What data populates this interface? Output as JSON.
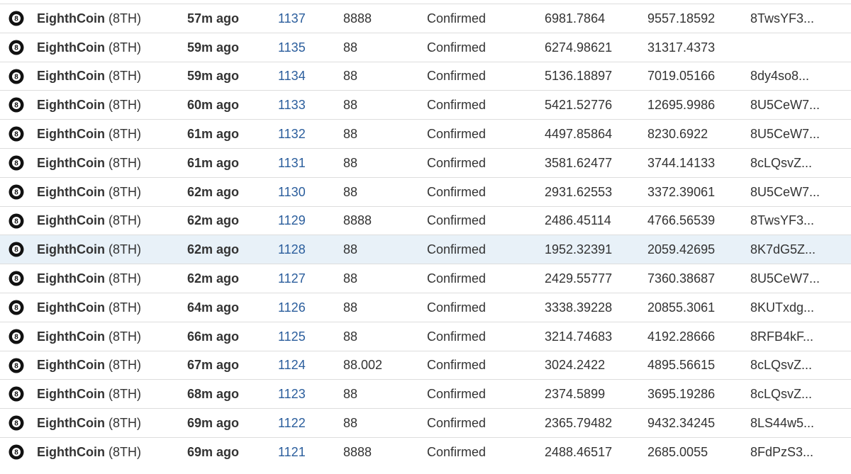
{
  "rows": [
    {
      "coin": "EighthCoin",
      "symbol": "(8TH)",
      "time": "57m ago",
      "height": "1137",
      "difficulty": "8888",
      "status": "Confirmed",
      "value_a": "6981.7864",
      "value_b": "9557.18592",
      "address": "8TwsYF3..."
    },
    {
      "coin": "EighthCoin",
      "symbol": "(8TH)",
      "time": "59m ago",
      "height": "1135",
      "difficulty": "88",
      "status": "Confirmed",
      "value_a": "6274.98621",
      "value_b": "31317.4373",
      "address": ""
    },
    {
      "coin": "EighthCoin",
      "symbol": "(8TH)",
      "time": "59m ago",
      "height": "1134",
      "difficulty": "88",
      "status": "Confirmed",
      "value_a": "5136.18897",
      "value_b": "7019.05166",
      "address": "8dy4so8..."
    },
    {
      "coin": "EighthCoin",
      "symbol": "(8TH)",
      "time": "60m ago",
      "height": "1133",
      "difficulty": "88",
      "status": "Confirmed",
      "value_a": "5421.52776",
      "value_b": "12695.9986",
      "address": "8U5CeW7..."
    },
    {
      "coin": "EighthCoin",
      "symbol": "(8TH)",
      "time": "61m ago",
      "height": "1132",
      "difficulty": "88",
      "status": "Confirmed",
      "value_a": "4497.85864",
      "value_b": "8230.6922",
      "address": "8U5CeW7..."
    },
    {
      "coin": "EighthCoin",
      "symbol": "(8TH)",
      "time": "61m ago",
      "height": "1131",
      "difficulty": "88",
      "status": "Confirmed",
      "value_a": "3581.62477",
      "value_b": "3744.14133",
      "address": "8cLQsvZ..."
    },
    {
      "coin": "EighthCoin",
      "symbol": "(8TH)",
      "time": "62m ago",
      "height": "1130",
      "difficulty": "88",
      "status": "Confirmed",
      "value_a": "2931.62553",
      "value_b": "3372.39061",
      "address": "8U5CeW7..."
    },
    {
      "coin": "EighthCoin",
      "symbol": "(8TH)",
      "time": "62m ago",
      "height": "1129",
      "difficulty": "8888",
      "status": "Confirmed",
      "value_a": "2486.45114",
      "value_b": "4766.56539",
      "address": "8TwsYF3..."
    },
    {
      "coin": "EighthCoin",
      "symbol": "(8TH)",
      "time": "62m ago",
      "height": "1128",
      "difficulty": "88",
      "status": "Confirmed",
      "value_a": "1952.32391",
      "value_b": "2059.42695",
      "address": "8K7dG5Z...",
      "highlight": true
    },
    {
      "coin": "EighthCoin",
      "symbol": "(8TH)",
      "time": "62m ago",
      "height": "1127",
      "difficulty": "88",
      "status": "Confirmed",
      "value_a": "2429.55777",
      "value_b": "7360.38687",
      "address": "8U5CeW7..."
    },
    {
      "coin": "EighthCoin",
      "symbol": "(8TH)",
      "time": "64m ago",
      "height": "1126",
      "difficulty": "88",
      "status": "Confirmed",
      "value_a": "3338.39228",
      "value_b": "20855.3061",
      "address": "8KUTxdg..."
    },
    {
      "coin": "EighthCoin",
      "symbol": "(8TH)",
      "time": "66m ago",
      "height": "1125",
      "difficulty": "88",
      "status": "Confirmed",
      "value_a": "3214.74683",
      "value_b": "4192.28666",
      "address": "8RFB4kF..."
    },
    {
      "coin": "EighthCoin",
      "symbol": "(8TH)",
      "time": "67m ago",
      "height": "1124",
      "difficulty": "88.002",
      "status": "Confirmed",
      "value_a": "3024.2422",
      "value_b": "4895.56615",
      "address": "8cLQsvZ..."
    },
    {
      "coin": "EighthCoin",
      "symbol": "(8TH)",
      "time": "68m ago",
      "height": "1123",
      "difficulty": "88",
      "status": "Confirmed",
      "value_a": "2374.5899",
      "value_b": "3695.19286",
      "address": "8cLQsvZ..."
    },
    {
      "coin": "EighthCoin",
      "symbol": "(8TH)",
      "time": "69m ago",
      "height": "1122",
      "difficulty": "88",
      "status": "Confirmed",
      "value_a": "2365.79482",
      "value_b": "9432.34245",
      "address": "8LS44w5..."
    },
    {
      "coin": "EighthCoin",
      "symbol": "(8TH)",
      "time": "69m ago",
      "height": "1121",
      "difficulty": "8888",
      "status": "Confirmed",
      "value_a": "2488.46517",
      "value_b": "2685.0055",
      "address": "8FdPzS3..."
    }
  ],
  "icon": {
    "name": "eight-ball-icon",
    "glyph": "8",
    "ball_color": "#111111",
    "face_color": "#ffffff"
  },
  "colors": {
    "link": "#2a5d9c",
    "highlight_row": "#e8f1f8",
    "text": "#333333"
  }
}
